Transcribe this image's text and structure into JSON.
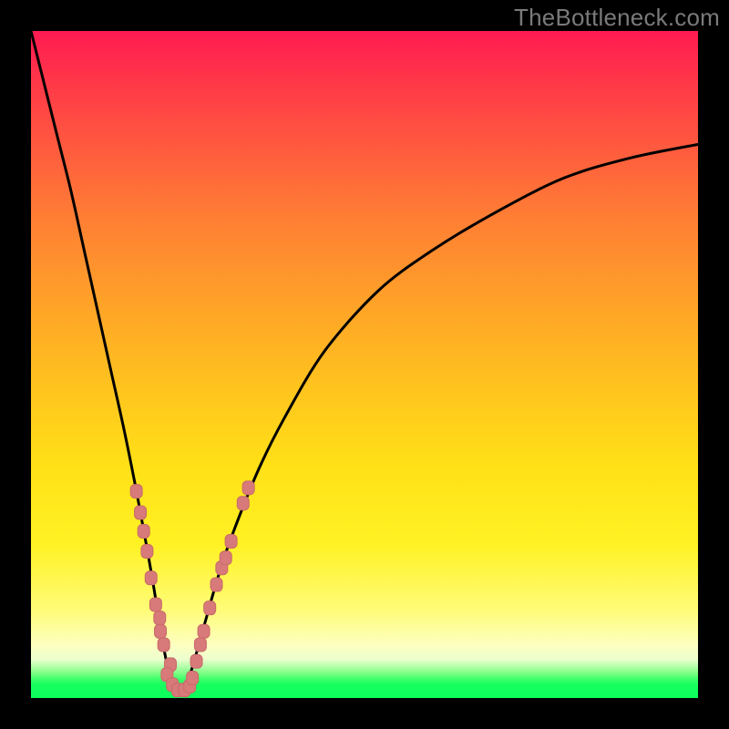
{
  "watermark": "TheBottleneck.com",
  "colors": {
    "frame": "#000000",
    "curve": "#000000",
    "marker_fill": "#d77a79",
    "marker_stroke": "#c96a69",
    "gradient_top": "#ff1a52",
    "gradient_bottom": "#0aff5c"
  },
  "chart_data": {
    "type": "line",
    "title": "",
    "xlabel": "",
    "ylabel": "",
    "xlim": [
      0,
      100
    ],
    "ylim": [
      0,
      100
    ],
    "grid": false,
    "legend": false,
    "note": "Axes have no visible tick labels; x/y are normalized 0–100 to the inner plot box. y=0 is the bottom (green), y=100 is the top (red). The curve represents bottleneck percentage vs. component balance with minimum near x≈22.",
    "series": [
      {
        "name": "bottleneck-curve",
        "x": [
          0,
          2,
          4,
          6,
          8,
          10,
          12,
          14,
          16,
          18,
          20,
          21,
          22,
          23,
          24,
          26,
          28,
          30,
          34,
          38,
          44,
          52,
          60,
          70,
          80,
          90,
          100
        ],
        "y": [
          100,
          92,
          84,
          76,
          67,
          58,
          49,
          40,
          30,
          19,
          7,
          3,
          1,
          2,
          4,
          11,
          18,
          24,
          34,
          42,
          52,
          61,
          67,
          73,
          78,
          81,
          83
        ]
      }
    ],
    "markers": {
      "name": "sample-points",
      "note": "Rounded-rectangle salmon markers clustered near the curve bottom (the V).",
      "points": [
        {
          "x": 15.8,
          "y": 31.0
        },
        {
          "x": 16.4,
          "y": 27.8
        },
        {
          "x": 16.9,
          "y": 25.0
        },
        {
          "x": 17.4,
          "y": 22.0
        },
        {
          "x": 18.0,
          "y": 18.0
        },
        {
          "x": 18.7,
          "y": 14.0
        },
        {
          "x": 19.3,
          "y": 12.0
        },
        {
          "x": 19.4,
          "y": 10.0
        },
        {
          "x": 19.9,
          "y": 8.0
        },
        {
          "x": 20.9,
          "y": 5.0
        },
        {
          "x": 20.4,
          "y": 3.5
        },
        {
          "x": 21.2,
          "y": 2.0
        },
        {
          "x": 22.0,
          "y": 1.2
        },
        {
          "x": 23.0,
          "y": 1.2
        },
        {
          "x": 23.8,
          "y": 1.8
        },
        {
          "x": 24.2,
          "y": 3.0
        },
        {
          "x": 24.8,
          "y": 5.5
        },
        {
          "x": 25.4,
          "y": 8.0
        },
        {
          "x": 25.9,
          "y": 10.0
        },
        {
          "x": 26.8,
          "y": 13.5
        },
        {
          "x": 27.8,
          "y": 17.0
        },
        {
          "x": 28.6,
          "y": 19.5
        },
        {
          "x": 29.2,
          "y": 21.0
        },
        {
          "x": 30.0,
          "y": 23.5
        },
        {
          "x": 31.8,
          "y": 29.2
        },
        {
          "x": 32.6,
          "y": 31.5
        }
      ]
    }
  }
}
